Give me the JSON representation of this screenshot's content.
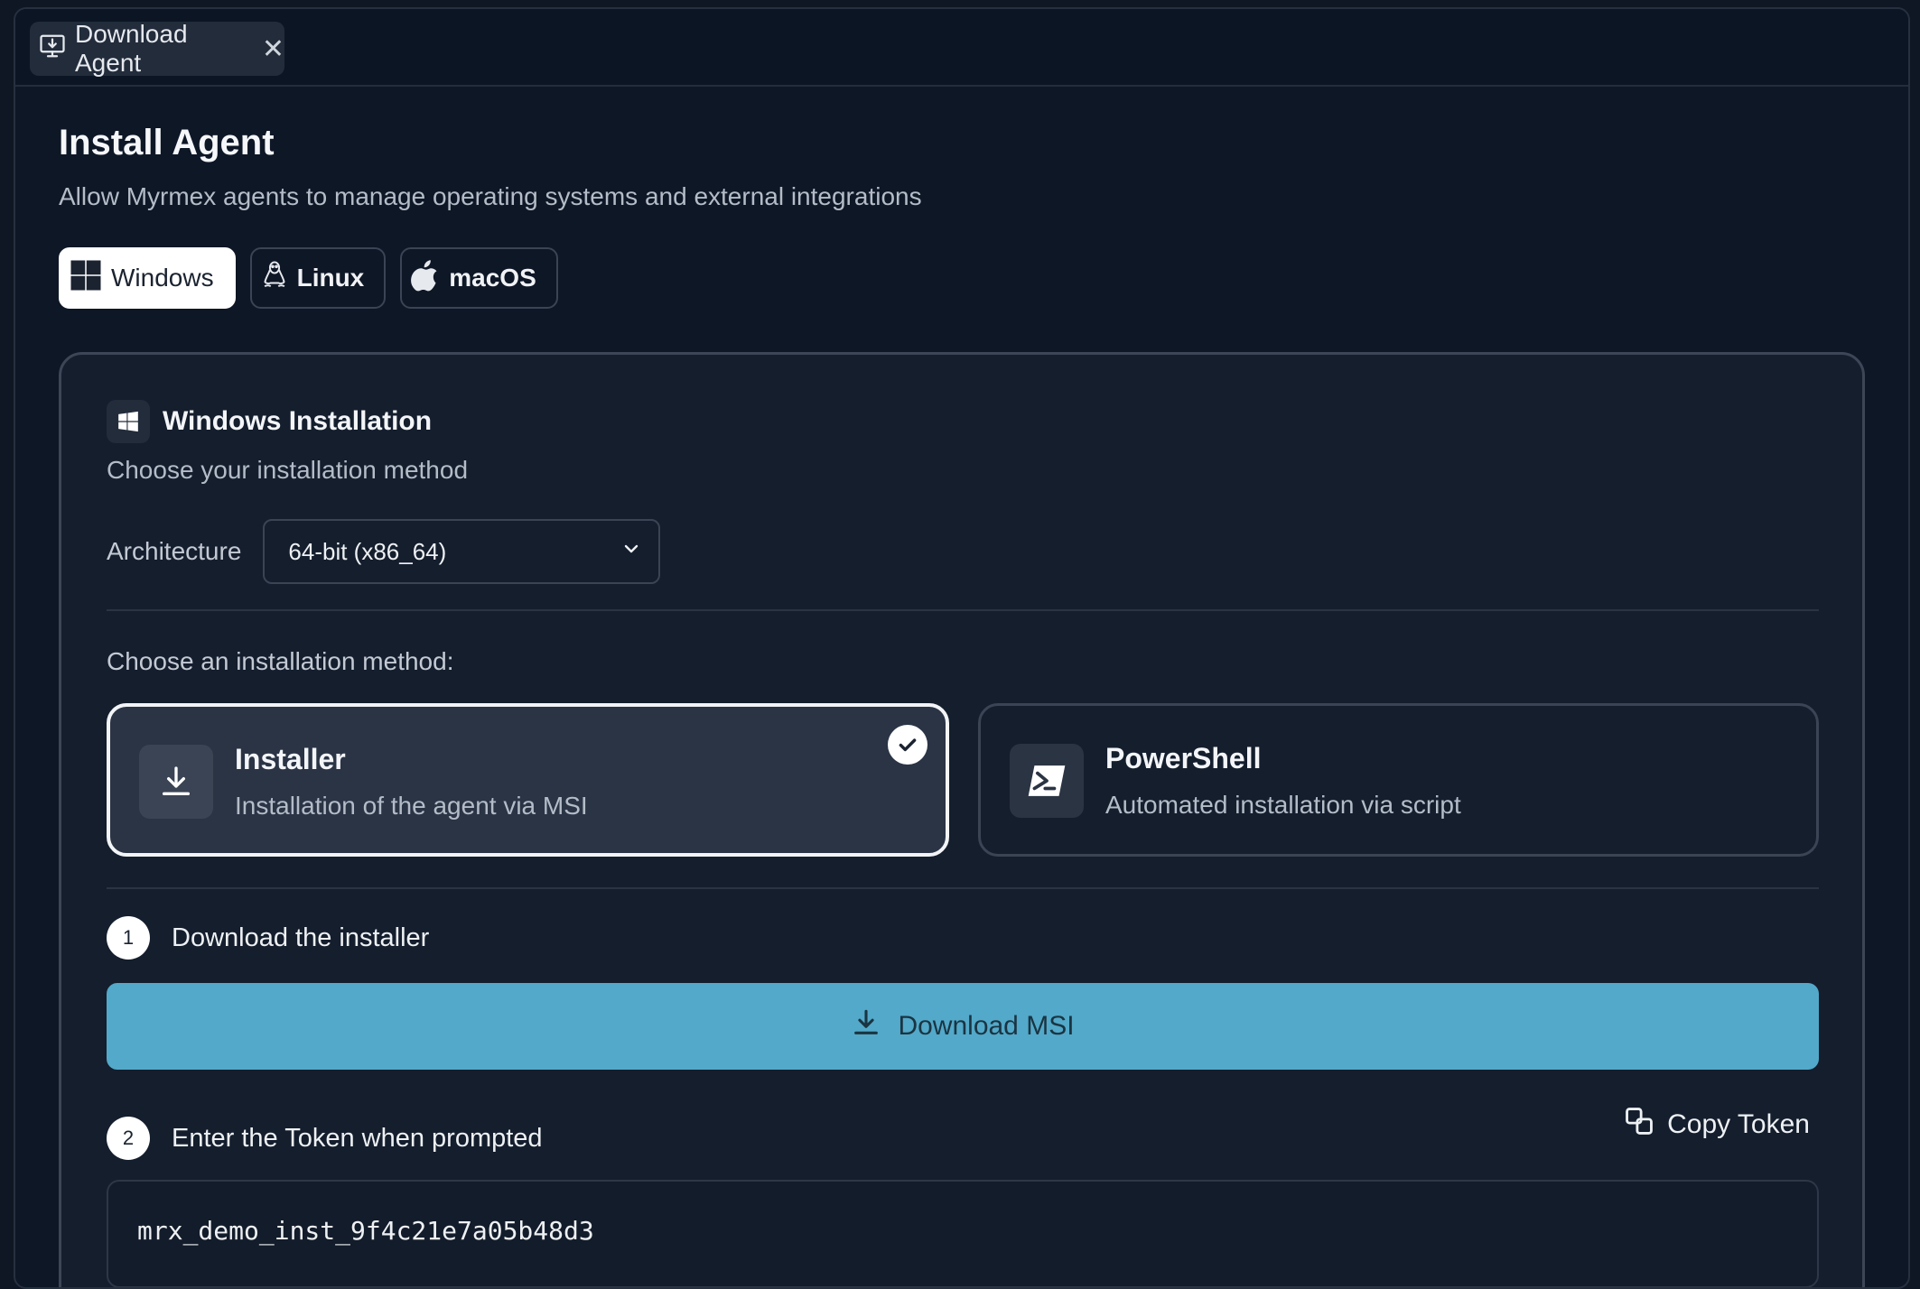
{
  "tab": {
    "label": "Download Agent",
    "close": "✕"
  },
  "page": {
    "title": "Install Agent",
    "subtitle": "Allow Myrmex agents to manage operating systems and external integrations"
  },
  "os_tabs": [
    {
      "label": "Windows",
      "icon": "windows-icon",
      "active": true
    },
    {
      "label": "Linux",
      "icon": "linux-icon",
      "active": false
    },
    {
      "label": "macOS",
      "icon": "apple-icon",
      "active": false
    }
  ],
  "card": {
    "title": "Windows Installation",
    "subtitle": "Choose your installation method",
    "architecture_label": "Architecture",
    "architecture_value": "64-bit (x86_64)",
    "method_prompt": "Choose an installation method:",
    "methods": [
      {
        "name": "Installer",
        "description": "Installation of the agent via MSI",
        "icon": "download-icon",
        "selected": true
      },
      {
        "name": "PowerShell",
        "description": "Automated installation via script",
        "icon": "powershell-icon",
        "selected": false
      }
    ],
    "steps": [
      {
        "number": "1",
        "text": "Download the installer"
      },
      {
        "number": "2",
        "text": "Enter the Token when prompted"
      }
    ],
    "download_button": "Download MSI",
    "copy_token": "Copy Token",
    "token": "mrx_demo_inst_9f4c21e7a05b48d3"
  },
  "colors": {
    "background": "#0f1724",
    "card": "#141e2d",
    "accent_button": "#53a9c9",
    "selected_border": "#f2f4f7"
  }
}
